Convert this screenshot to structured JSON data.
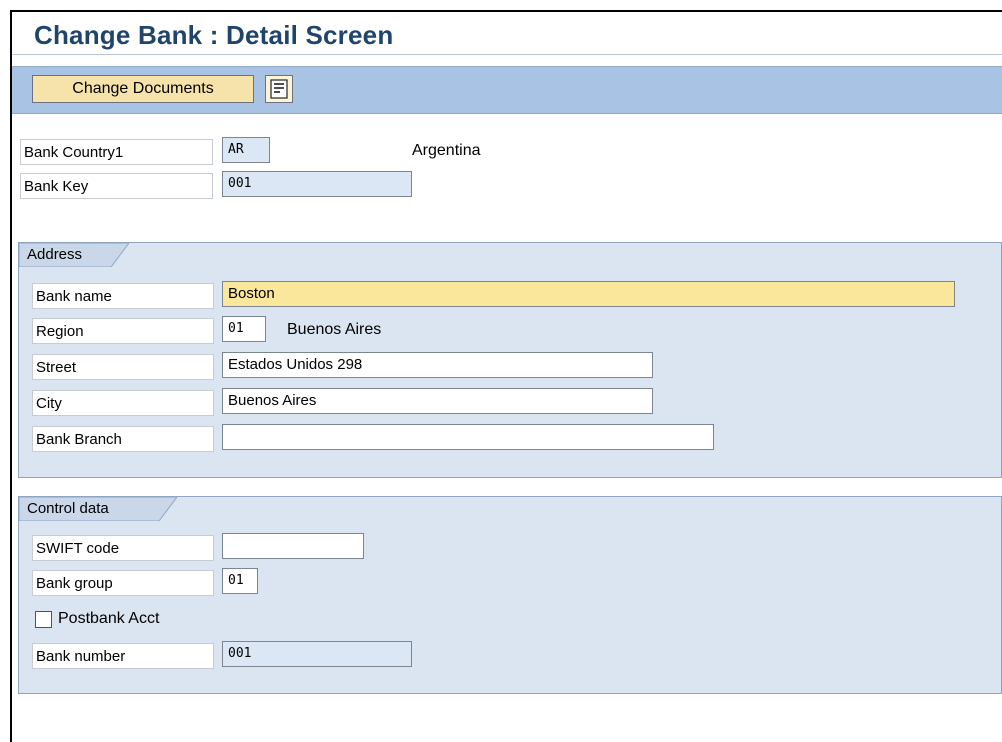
{
  "title": "Change Bank : Detail Screen",
  "toolbar": {
    "change_documents_label": "Change Documents",
    "icon": "detail-list-icon"
  },
  "header_fields": {
    "bank_country_label": "Bank Country1",
    "bank_country_value": "AR",
    "bank_country_text": "Argentina",
    "bank_key_label": "Bank Key",
    "bank_key_value": "001"
  },
  "address": {
    "group_title": "Address",
    "bank_name_label": "Bank name",
    "bank_name_value": "Boston",
    "region_label": "Region",
    "region_value": "01",
    "region_text": "Buenos Aires",
    "street_label": "Street",
    "street_value": "Estados Unidos 298",
    "city_label": "City",
    "city_value": "Buenos Aires",
    "bank_branch_label": "Bank Branch",
    "bank_branch_value": ""
  },
  "control_data": {
    "group_title": "Control data",
    "swift_code_label": "SWIFT code",
    "swift_code_value": "",
    "bank_group_label": "Bank group",
    "bank_group_value": "01",
    "postbank_label": "Postbank Acct",
    "postbank_checked": false,
    "bank_number_label": "Bank number",
    "bank_number_value": "001"
  },
  "colors": {
    "title_text": "#20456d",
    "toolbar_bg": "#a9c3e4",
    "group_bg": "#dbe5f1",
    "required_field": "#fbe79c",
    "readonly_field": "#dce7f5"
  }
}
